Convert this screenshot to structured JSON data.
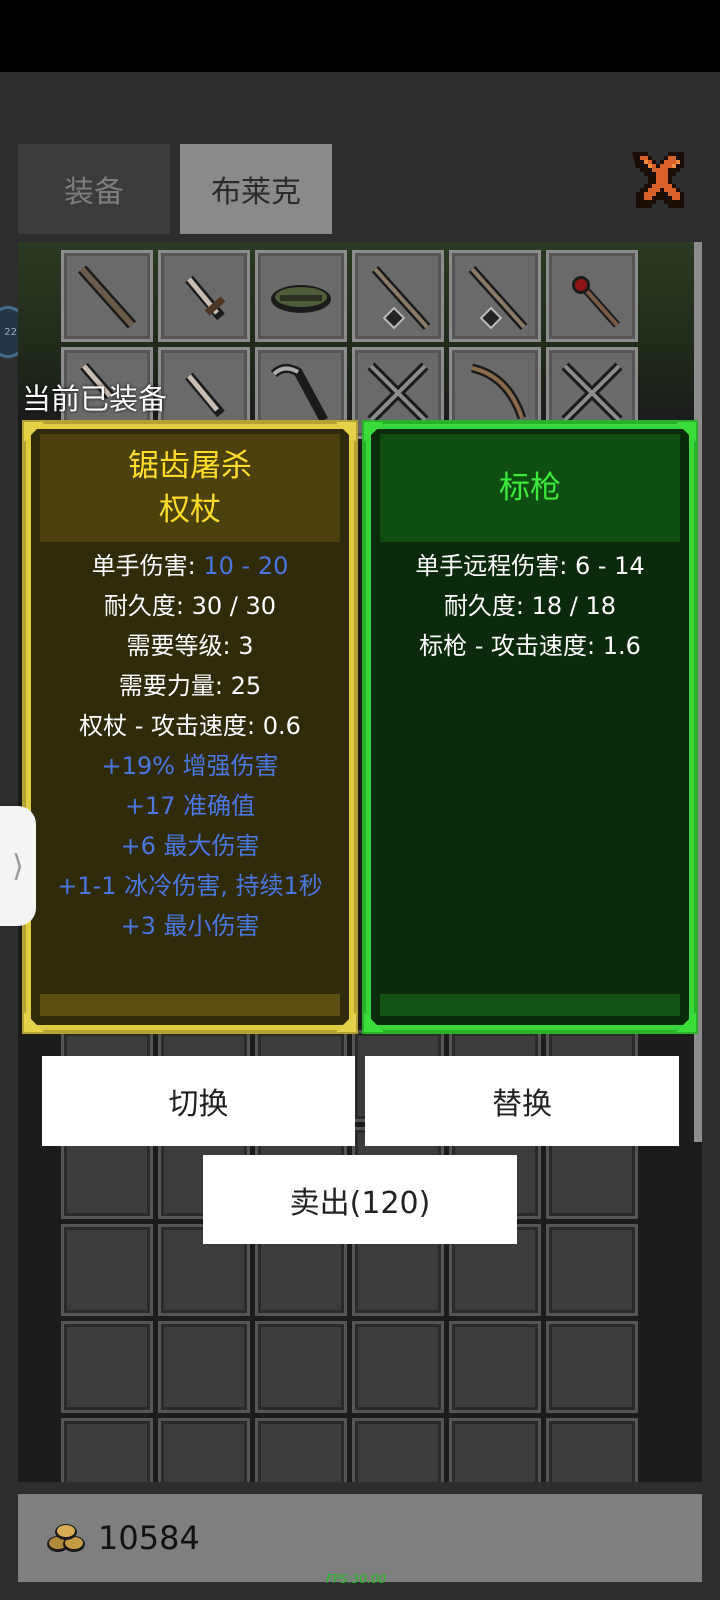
{
  "tabs": {
    "equip": "装备",
    "blake": "布莱克"
  },
  "side_avatar_text": "22",
  "equipped_label": "当前已装备",
  "selected_item": {
    "name_line1": "锯齿屠杀",
    "name_line2": "权杖",
    "rarity_color": "#ffdc2a",
    "stats": [
      {
        "label": "单手伤害: ",
        "value": "10 - 20"
      },
      {
        "text": "耐久度: 30 / 30"
      },
      {
        "text": "需要等级: 3"
      },
      {
        "text": "需要力量: 25"
      },
      {
        "text": "权杖 - 攻击速度: 0.6"
      }
    ],
    "affixes": [
      "+19% 增强伤害",
      "+17 准确值",
      "+6 最大伤害",
      "+1-1 冰冷伤害, 持续1秒",
      "+3 最小伤害"
    ]
  },
  "equipped_item": {
    "name": "标枪",
    "rarity_color": "#3bea3b",
    "stats": [
      "单手远程伤害: 6 - 14",
      "耐久度: 18 / 18",
      "标枪 - 攻击速度: 1.6"
    ]
  },
  "buttons": {
    "switch": "切换",
    "replace": "替换",
    "sell": "卖出(120)"
  },
  "gold": "10584",
  "fps": "FPS:30.00",
  "side_handle_glyph": "⟩",
  "colors": {
    "affix_blue": "#4a77e0",
    "gold_border": "#e0cd43",
    "green_border": "#39d63a"
  }
}
